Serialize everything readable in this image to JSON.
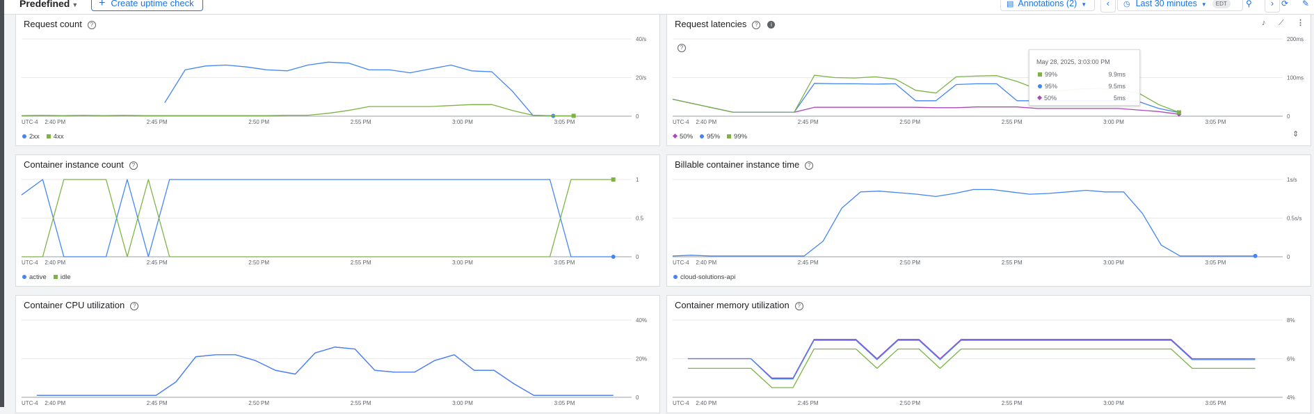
{
  "toolbar": {
    "predefined_label": "Predefined",
    "create_uptime_label": "Create uptime check",
    "annotations_label": "Annotations (2)",
    "time_range_label": "Last 30 minutes",
    "timezone_badge": "EDT"
  },
  "colors": {
    "blue": "#4285f4",
    "green": "#7cb342",
    "purple": "#ab47bc",
    "grid": "#e8eaed",
    "axis": "#9aa0a6",
    "text": "#5f6368"
  },
  "panels": {
    "request_count": {
      "title": "Request count"
    },
    "request_latencies": {
      "title": "Request latencies"
    },
    "instance_count": {
      "title": "Container instance count"
    },
    "billable_time": {
      "title": "Billable container instance time"
    },
    "cpu_util": {
      "title": "Container CPU utilization"
    },
    "memory_util": {
      "title": "Container memory utilization"
    }
  },
  "tooltip": {
    "time": "May 28, 2025, 3:03:00 PM",
    "rows": [
      {
        "label": "99%",
        "value": "9.9ms"
      },
      {
        "label": "95%",
        "value": "9.5ms"
      },
      {
        "label": "50%",
        "value": "5ms"
      }
    ]
  },
  "chart_data": [
    {
      "id": "request_count",
      "type": "line",
      "title": "Request count",
      "x": [
        "2:38",
        "2:39",
        "2:40",
        "2:41",
        "2:42",
        "2:43",
        "2:44",
        "2:45",
        "2:46",
        "2:47",
        "2:48",
        "2:49",
        "2:50",
        "2:51",
        "2:52",
        "2:53",
        "2:54",
        "2:55",
        "2:56",
        "2:57",
        "2:58",
        "2:59",
        "3:00",
        "3:01",
        "3:02",
        "3:03",
        "3:04",
        "3:05"
      ],
      "x_ticks": [
        "UTC-4",
        "2:40 PM",
        "2:45 PM",
        "2:50 PM",
        "2:55 PM",
        "3:00 PM",
        "3:05 PM"
      ],
      "y_ticks": [
        "40/s",
        "20/s",
        "0"
      ],
      "ylim": [
        0,
        40
      ],
      "series": [
        {
          "name": "2xx",
          "color": "#4285f4",
          "marker": "dot",
          "values": [
            null,
            null,
            null,
            null,
            null,
            null,
            null,
            7,
            24,
            26,
            26.5,
            25.5,
            24,
            23.5,
            26.5,
            28,
            27.5,
            24,
            24,
            22.5,
            24.5,
            26.5,
            23.5,
            23,
            13,
            0.5,
            0.2,
            null
          ]
        },
        {
          "name": "4xx",
          "color": "#7cb342",
          "marker": "square",
          "values": [
            0.3,
            0.5,
            0.3,
            0.5,
            0.3,
            0.5,
            0.3,
            0.3,
            0.3,
            0.3,
            0.3,
            0.3,
            0.3,
            0.5,
            0.5,
            1.5,
            3,
            5,
            5,
            5,
            5,
            5.5,
            6,
            6,
            3,
            0.5,
            0.2,
            0.2
          ]
        }
      ]
    },
    {
      "id": "request_latencies",
      "type": "line",
      "title": "Request latencies",
      "x": [
        "2:38",
        "2:39",
        "2:40",
        "2:41",
        "2:42",
        "2:43",
        "2:44",
        "2:45",
        "2:46",
        "2:47",
        "2:48",
        "2:49",
        "2:50",
        "2:51",
        "2:52",
        "2:53",
        "2:54",
        "2:55",
        "2:56",
        "2:57",
        "2:58",
        "2:59",
        "3:00",
        "3:01",
        "3:02",
        "3:03"
      ],
      "x_ticks": [
        "UTC-4",
        "2:40 PM",
        "2:45 PM",
        "2:50 PM",
        "2:55 PM",
        "3:00 PM",
        "3:05 PM"
      ],
      "y_ticks": [
        "200ms",
        "100ms",
        "0"
      ],
      "ylim": [
        0,
        200
      ],
      "series": [
        {
          "name": "50%",
          "color": "#ab47bc",
          "marker": "diamond",
          "values": [
            44,
            null,
            null,
            10,
            null,
            null,
            10,
            23,
            23,
            23,
            23,
            23,
            23,
            22,
            22,
            24,
            24,
            24,
            20,
            20,
            20,
            20,
            20,
            16,
            12,
            5
          ]
        },
        {
          "name": "95%",
          "color": "#4285f4",
          "marker": "dot",
          "values": [
            44,
            null,
            null,
            10,
            null,
            null,
            10,
            85,
            84,
            84,
            83,
            84,
            40,
            40,
            82,
            84,
            84,
            40,
            40,
            40,
            40,
            40,
            40,
            38,
            20,
            9.5
          ]
        },
        {
          "name": "99%",
          "color": "#7cb342",
          "marker": "square",
          "values": [
            44,
            null,
            null,
            10,
            null,
            null,
            10,
            106,
            100,
            99,
            102,
            96,
            67,
            60,
            102,
            104,
            105,
            90,
            70,
            65,
            70,
            72,
            68,
            60,
            30,
            9.9
          ]
        }
      ]
    },
    {
      "id": "instance_count",
      "type": "line",
      "title": "Container instance count",
      "x_ticks": [
        "UTC-4",
        "2:40 PM",
        "2:45 PM",
        "2:50 PM",
        "2:55 PM",
        "3:00 PM",
        "3:05 PM"
      ],
      "y_ticks": [
        "1",
        "0.5",
        "0"
      ],
      "ylim": [
        0,
        1
      ],
      "series": [
        {
          "name": "active",
          "color": "#4285f4",
          "marker": "dot",
          "values": [
            0.8,
            1,
            0,
            0,
            0,
            1,
            0,
            1,
            1,
            1,
            1,
            1,
            1,
            1,
            1,
            1,
            1,
            1,
            1,
            1,
            1,
            1,
            1,
            1,
            1,
            1,
            0,
            0,
            0
          ]
        },
        {
          "name": "idle",
          "color": "#7cb342",
          "marker": "square",
          "values": [
            0,
            0,
            1,
            1,
            1,
            0,
            1,
            0,
            0,
            0,
            0,
            0,
            0,
            0,
            0,
            0,
            0,
            0,
            0,
            0,
            0,
            0,
            0,
            0,
            0,
            0,
            1,
            1,
            1
          ]
        }
      ]
    },
    {
      "id": "billable_time",
      "type": "line",
      "title": "Billable container instance time",
      "x_ticks": [
        "UTC-4",
        "2:40 PM",
        "2:45 PM",
        "2:50 PM",
        "2:55 PM",
        "3:00 PM",
        "3:05 PM"
      ],
      "y_ticks": [
        "1s/s",
        "0.5s/s",
        "0"
      ],
      "ylim": [
        0,
        1
      ],
      "series": [
        {
          "name": "cloud-solutions-api",
          "color": "#4285f4",
          "marker": "dot",
          "values": [
            0.01,
            0.02,
            0.01,
            0.01,
            0.01,
            0.01,
            0.01,
            0.01,
            0.2,
            0.63,
            0.84,
            0.85,
            0.83,
            0.81,
            0.78,
            0.82,
            0.87,
            0.87,
            0.84,
            0.81,
            0.82,
            0.84,
            0.86,
            0.84,
            0.84,
            0.56,
            0.15,
            0.01,
            0.01,
            0.01,
            0.01,
            0.01
          ]
        }
      ]
    },
    {
      "id": "cpu_util",
      "type": "line",
      "title": "Container CPU utilization",
      "x_ticks": [
        "UTC-4",
        "2:40 PM",
        "2:45 PM",
        "2:50 PM",
        "2:55 PM",
        "3:00 PM",
        "3:05 PM"
      ],
      "y_ticks": [
        "40%",
        "20%",
        "0"
      ],
      "ylim": [
        0,
        40
      ],
      "series": [
        {
          "name": "purple",
          "color": "#ab47bc",
          "values": [
            1,
            1,
            1,
            1,
            1,
            1,
            1,
            8,
            21,
            22,
            22,
            19,
            14,
            12,
            23,
            26,
            25,
            14,
            13,
            13,
            19,
            22,
            14,
            14,
            7,
            1,
            1,
            1,
            1,
            1
          ]
        },
        {
          "name": "blue",
          "color": "#4285f4",
          "values": [
            1,
            1,
            1,
            1,
            1,
            1,
            1,
            8,
            21,
            22,
            22,
            19,
            14,
            12,
            23,
            26,
            25,
            14,
            13,
            13,
            19,
            22,
            14,
            14,
            7,
            1,
            1,
            1,
            1,
            1
          ]
        }
      ]
    },
    {
      "id": "memory_util",
      "type": "line",
      "title": "Container memory utilization",
      "x_ticks": [
        "UTC-4",
        "2:40 PM",
        "2:45 PM",
        "2:50 PM",
        "2:55 PM",
        "3:00 PM",
        "3:05 PM"
      ],
      "y_ticks": [
        "8%",
        "6%",
        "4%"
      ],
      "ylim": [
        4,
        8
      ],
      "series": [
        {
          "name": "purple",
          "color": "#ab47bc",
          "values": [
            6,
            6,
            6,
            6,
            5,
            5,
            7,
            7,
            7,
            6,
            7,
            7,
            6,
            7,
            7,
            7,
            7,
            7,
            7,
            7,
            7,
            7,
            7,
            7,
            6,
            6,
            6,
            6
          ]
        },
        {
          "name": "blue",
          "color": "#4285f4",
          "values": [
            6,
            6,
            6,
            6,
            4.95,
            4.95,
            6.95,
            6.95,
            6.95,
            5.95,
            6.95,
            6.95,
            5.95,
            6.95,
            6.95,
            6.95,
            6.95,
            6.95,
            6.95,
            6.95,
            6.95,
            6.95,
            6.95,
            6.95,
            5.95,
            5.95,
            5.95,
            5.95
          ]
        },
        {
          "name": "green",
          "color": "#7cb342",
          "values": [
            5.5,
            5.5,
            5.5,
            5.5,
            4.5,
            4.5,
            6.5,
            6.5,
            6.5,
            5.5,
            6.5,
            6.5,
            5.5,
            6.5,
            6.5,
            6.5,
            6.5,
            6.5,
            6.5,
            6.5,
            6.5,
            6.5,
            6.5,
            6.5,
            5.5,
            5.5,
            5.5,
            5.5
          ]
        }
      ]
    }
  ]
}
